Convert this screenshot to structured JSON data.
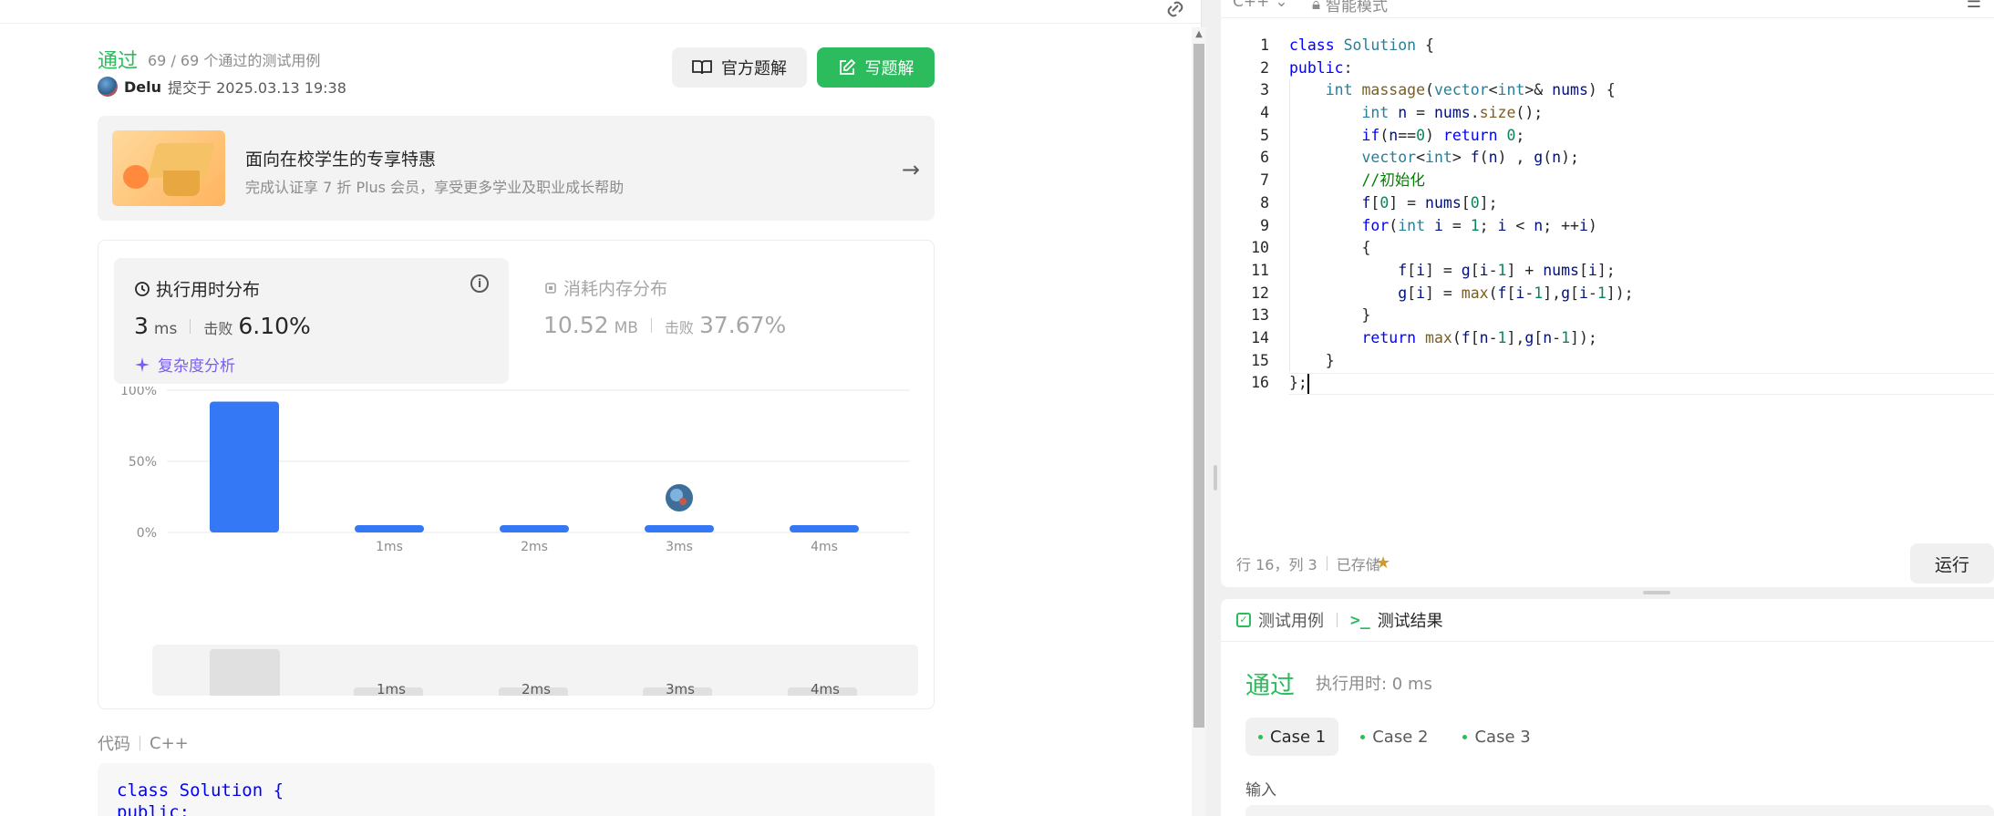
{
  "submission": {
    "status": "通过",
    "passed_text": "69 / 69 个通过的测试用例",
    "author_name": "Delu",
    "submitted_text": "提交于 2025.03.13 19:38",
    "official_solution_label": "官方题解",
    "write_solution_label": "写题解"
  },
  "promo": {
    "title": "面向在校学生的专享特惠",
    "subtitle": "完成认证享 7 折 Plus 会员，享受更多学业及职业成长帮助"
  },
  "runtime": {
    "tab_label": "执行用时分布",
    "value": "3",
    "unit": "ms",
    "beats_label": "击败",
    "beats_value": "6.10%",
    "complexity_label": "复杂度分析"
  },
  "memory": {
    "tab_label": "消耗内存分布",
    "value": "10.52",
    "unit": "MB",
    "beats_label": "击败",
    "beats_value": "37.67%"
  },
  "chart_data": {
    "type": "bar",
    "categories": [
      "",
      "1ms",
      "2ms",
      "3ms",
      "4ms"
    ],
    "values": [
      92,
      3,
      3,
      3,
      3
    ],
    "ylim": [
      0,
      100
    ],
    "yticks": [
      "100%",
      "50%",
      "0%"
    ],
    "grid": true,
    "marker_category": "3ms",
    "bar_color": "#3478f6"
  },
  "minimap": {
    "labels": [
      "1ms",
      "2ms",
      "3ms",
      "4ms"
    ]
  },
  "code_section": {
    "label": "代码",
    "lang": "C++",
    "preview_line1": "class Solution {",
    "preview_line2": "public:"
  },
  "editor": {
    "language": "C++",
    "mode": "智能模式",
    "lines": [
      "class Solution {",
      "public:",
      "    int massage(vector<int>& nums) {",
      "        int n = nums.size();",
      "        if(n==0) return 0;",
      "        vector<int> f(n) , g(n);",
      "        //初始化",
      "        f[0] = nums[0];",
      "        for(int i = 1; i < n; ++i)",
      "        {",
      "            f[i] = g[i-1] + nums[i];",
      "            g[i] = max(f[i-1],g[i-1]);",
      "        }",
      "        return max(f[n-1],g[n-1]);",
      "    }",
      "};"
    ],
    "position_text": "行 16，列 3",
    "saved_text": "已存储",
    "run_label": "运行"
  },
  "results": {
    "tab_testcase": "测试用例",
    "tab_result": "测试结果",
    "status": "通过",
    "runtime_text": "执行用时: 0 ms",
    "cases": [
      "Case 1",
      "Case 2",
      "Case 3"
    ],
    "input_label": "输入"
  },
  "colors": {
    "accent_green": "#2cbb5d",
    "bar_blue": "#3478f6",
    "purple": "#7a5af8"
  }
}
